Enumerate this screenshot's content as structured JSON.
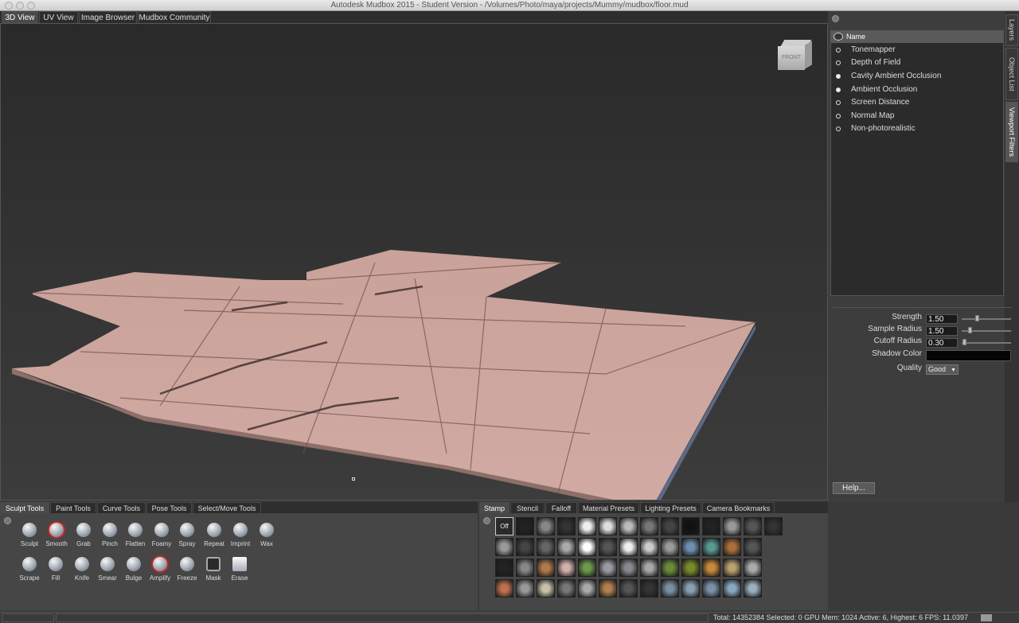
{
  "window": {
    "title": "Autodesk Mudbox 2015 - Student Version - /Volumes/Photo/maya/projects/Mummy/mudbox/floor.mud"
  },
  "view_tabs": [
    "3D View",
    "UV View",
    "Image Browser",
    "Mudbox Community"
  ],
  "viewcube_label": "FRONT",
  "side_tabs": [
    "Layers",
    "Object List",
    "Viewport Filters"
  ],
  "filters": {
    "header": "Name",
    "items": [
      {
        "label": "Tonemapper",
        "on": false
      },
      {
        "label": "Depth of Field",
        "on": false
      },
      {
        "label": "Cavity Ambient Occlusion",
        "on": true
      },
      {
        "label": "Ambient Occlusion",
        "on": true
      },
      {
        "label": "Screen Distance",
        "on": false
      },
      {
        "label": "Normal Map",
        "on": false
      },
      {
        "label": "Non-photorealistic",
        "on": false
      }
    ]
  },
  "properties": {
    "strength_label": "Strength",
    "strength_value": "1.50",
    "sample_radius_label": "Sample Radius",
    "sample_radius_value": "1.50",
    "cutoff_radius_label": "Cutoff Radius",
    "cutoff_radius_value": "0.30",
    "shadow_color_label": "Shadow Color",
    "shadow_color": "#050505",
    "quality_label": "Quality",
    "quality_value": "Good"
  },
  "help_button": "Help...",
  "tool_tabs": [
    "Sculpt Tools",
    "Paint Tools",
    "Curve Tools",
    "Pose Tools",
    "Select/Move Tools"
  ],
  "sculpt_tools_row1": [
    "Sculpt",
    "Smooth",
    "Grab",
    "Pinch",
    "Flatten",
    "Foamy",
    "Spray",
    "Repeat",
    "Imprint",
    "Wax"
  ],
  "sculpt_tools_row2": [
    "Scrape",
    "Fill",
    "Knife",
    "Smear",
    "Bulge",
    "Amplify",
    "Freeze",
    "Mask",
    "Erase"
  ],
  "stamp_tabs": [
    "Stamp",
    "Stencil",
    "Falloff",
    "Material Presets",
    "Lighting Presets",
    "Camera Bookmarks"
  ],
  "stamp_off_label": "Off",
  "status": {
    "text": "Total: 14352384  Selected: 0 GPU Mem: 1024  Active: 6, Highest: 6  FPS: 11.0397"
  },
  "colors": {
    "floor": "#c9a29a",
    "floor_shadow": "#8d6e68",
    "panel": "#3d3d3d",
    "accent": "#5a5a5a"
  }
}
